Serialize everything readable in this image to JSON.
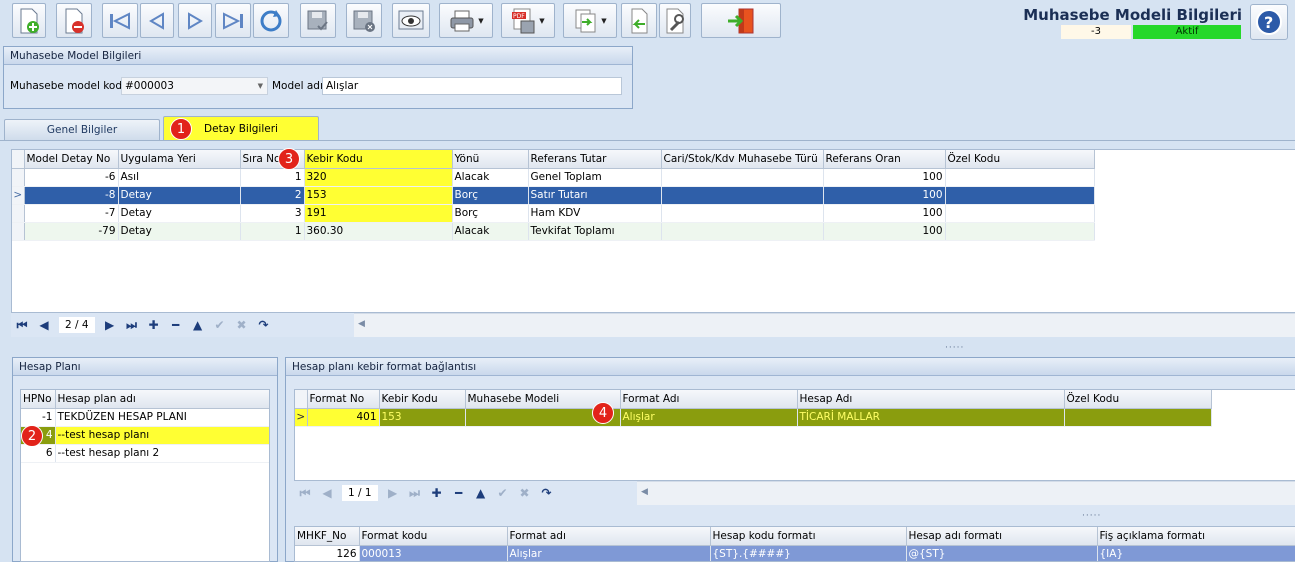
{
  "toolbar": {
    "buttons": [
      "new-record",
      "delete-record",
      "first",
      "previous",
      "next",
      "last",
      "refresh",
      "save",
      "cancel-save",
      "preview",
      "print",
      "pdf-export",
      "export",
      "import",
      "tools",
      "exit"
    ]
  },
  "header": {
    "title": "Muhasebe Modeli Bilgileri",
    "status_number": "-3",
    "status_label": "Aktif",
    "status_color": "#26d82a"
  },
  "model_group": {
    "title": "Muhasebe Model Bilgileri",
    "code_label": "Muhasebe model kodu",
    "code_value": "#000003",
    "name_label": "Model adı",
    "name_value": "Alışlar"
  },
  "tabs": [
    {
      "label": "Genel Bilgiler",
      "active": false
    },
    {
      "label": "Detay Bilgileri",
      "active": true
    }
  ],
  "badges": [
    "1",
    "2",
    "3",
    "4"
  ],
  "detail_grid": {
    "columns": [
      "Model Detay No",
      "Uygulama Yeri",
      "Sıra No",
      "Kebir Kodu",
      "Yönü",
      "Referans Tutar",
      "Cari/Stok/Kdv Muhasebe Türü",
      "Referans Oran",
      "Özel Kodu"
    ],
    "rows": [
      {
        "no": "-6",
        "yer": "Asıl",
        "sira": "1",
        "kebir": "320",
        "yon": "Alacak",
        "ref": "Genel Toplam",
        "tur": "",
        "oran": "100",
        "ozel": ""
      },
      {
        "no": "-8",
        "yer": "Detay",
        "sira": "2",
        "kebir": "153",
        "yon": "Borç",
        "ref": "Satır Tutarı",
        "tur": "",
        "oran": "100",
        "ozel": ""
      },
      {
        "no": "-7",
        "yer": "Detay",
        "sira": "3",
        "kebir": "191",
        "yon": "Borç",
        "ref": "Ham KDV",
        "tur": "",
        "oran": "100",
        "ozel": ""
      },
      {
        "no": "-79",
        "yer": "Detay",
        "sira": "1",
        "kebir": "360.30",
        "yon": "Alacak",
        "ref": "Tevkifat Toplamı",
        "tur": "",
        "oran": "100",
        "ozel": ""
      }
    ],
    "position": "2 / 4"
  },
  "hesap_plani": {
    "title": "Hesap Planı",
    "columns": [
      "HPNo",
      "Hesap plan adı"
    ],
    "rows": [
      {
        "no": "-1",
        "name": "TEKDÜZEN HESAP PLANI"
      },
      {
        "no": "4",
        "name": "--test hesap planı"
      },
      {
        "no": "6",
        "name": "--test hesap planı 2"
      }
    ]
  },
  "format_baglanti": {
    "title": "Hesap planı kebir format bağlantısı",
    "columns": [
      "Format No",
      "Kebir Kodu",
      "Muhasebe Modeli",
      "Format Adı",
      "Hesap Adı",
      "Özel Kodu"
    ],
    "rows": [
      {
        "no": "401",
        "kebir": "153",
        "model": "",
        "format": "Alışlar",
        "hesap": "TİCARİ MALLAR",
        "ozel": ""
      }
    ],
    "position": "1 / 1"
  },
  "format_detail": {
    "columns": [
      "MHKF_No",
      "Format kodu",
      "Format adı",
      "Hesap kodu formatı",
      "Hesap adı formatı",
      "Fiş açıklama formatı"
    ],
    "rows": [
      {
        "no": "126",
        "kod": "000013",
        "ad": "Alışlar",
        "hkf": "{ST}.{####}",
        "haf": "@{ST}",
        "fis": "{IA}"
      }
    ]
  }
}
